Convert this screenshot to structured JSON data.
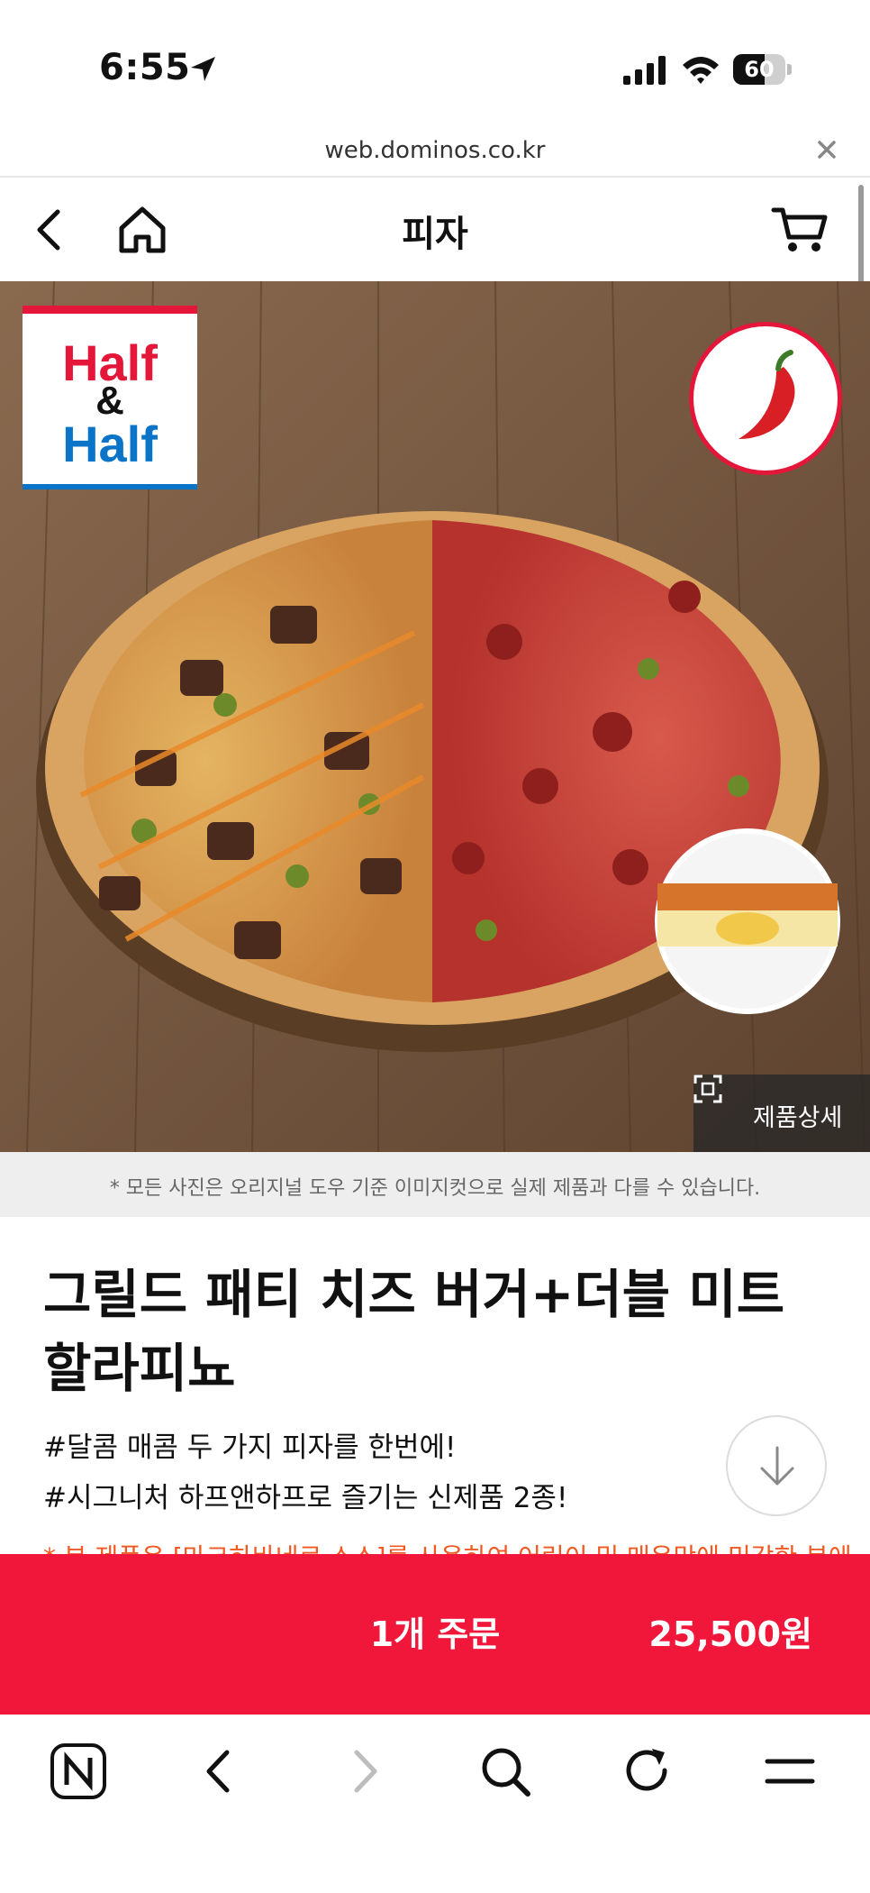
{
  "status_bar": {
    "time": "6:55",
    "battery_level": "60",
    "battery_fraction": 0.6
  },
  "browser": {
    "url": "web.dominos.co.kr"
  },
  "nav": {
    "title": "피자"
  },
  "hero": {
    "badge": {
      "line1": "Half",
      "line2": "&",
      "line3": "Half"
    },
    "detail_label": "제품상세"
  },
  "disclaimer": "* 모든 사진은 오리지널 도우 기준 이미지컷으로 실제 제품과 다를 수 있습니다.",
  "product": {
    "title": "그릴드 패티 치즈 버거+더블 미트 할라피뇨",
    "tags": [
      "#달콤 매콤 두 가지 피자를 한번에!",
      "#시그니처 하프앤하프로 즐기는 신제품 2종!"
    ],
    "warning": "* 본 제품은 [마크하바네로 소스]를 사용하여 어린이 및 매운맛에 민감한 분에"
  },
  "order": {
    "label": "1개 주문",
    "price": "25,500원"
  },
  "colors": {
    "brand_red": "#f0173b",
    "badge_blue": "#0a74c8",
    "warning_orange": "#f05a22"
  },
  "icons": [
    "location-arrow-icon",
    "signal-icon",
    "wifi-icon",
    "battery-icon",
    "close-icon",
    "back-icon",
    "home-icon",
    "cart-icon",
    "chili-pepper-icon",
    "expand-icon",
    "arrow-down-icon",
    "naver-n-icon",
    "browser-back-icon",
    "browser-forward-icon",
    "search-icon",
    "reload-icon",
    "menu-icon"
  ]
}
